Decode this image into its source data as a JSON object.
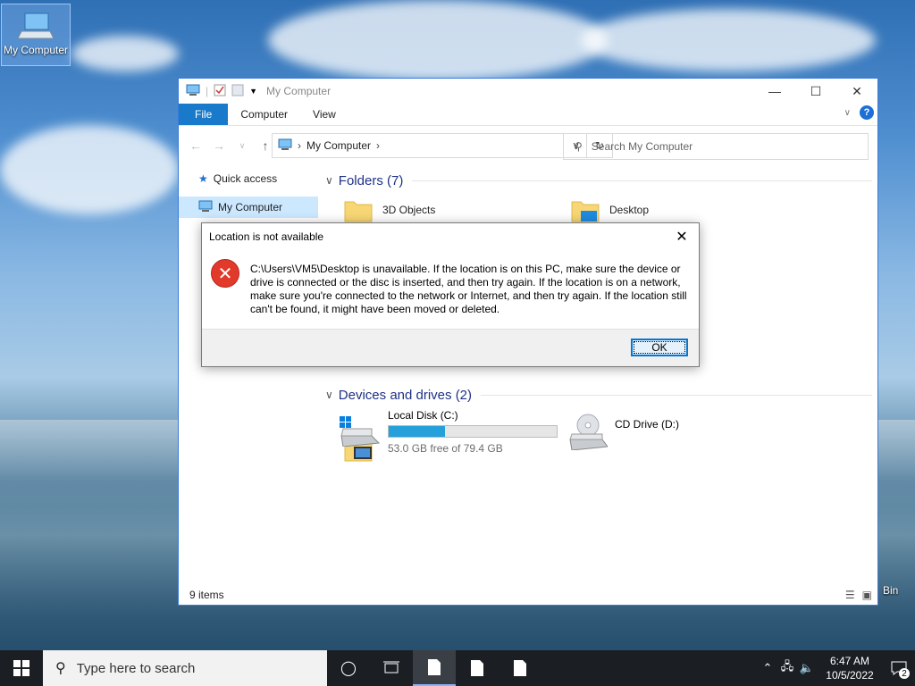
{
  "desktop": {
    "icons": [
      {
        "label": "My Computer"
      },
      {
        "label": "Bin"
      }
    ]
  },
  "explorer": {
    "title": "My Computer",
    "ribbon_tabs": [
      "File",
      "Computer",
      "View"
    ],
    "address": {
      "crumb": "My Computer"
    },
    "search": {
      "placeholder": "Search My Computer"
    },
    "nav": [
      {
        "label": "Quick access",
        "icon": "star-icon"
      },
      {
        "label": "My Computer",
        "icon": "computer-icon",
        "selected": true
      }
    ],
    "folders_header": "Folders (7)",
    "folders": [
      {
        "name": "3D Objects"
      },
      {
        "name": "Desktop"
      }
    ],
    "drives_header": "Devices and drives (2)",
    "drives": [
      {
        "name": "Local Disk (C:)",
        "free": "53.0 GB free of 79.4 GB",
        "used_fraction": 0.333
      },
      {
        "name": "CD Drive (D:)"
      }
    ],
    "status": "9 items"
  },
  "dialog": {
    "title": "Location is not available",
    "message": "C:\\Users\\VM5\\Desktop is unavailable. If the location is on this PC, make sure the device or drive is connected or the disc is inserted, and then try again. If the location is on a network, make sure you're connected to the network or Internet, and then try again. If the location still can't be found, it might have been moved or deleted.",
    "ok_label": "OK"
  },
  "taskbar": {
    "search_placeholder": "Type here to search",
    "time": "6:47 AM",
    "date": "10/5/2022",
    "notification_count": "2"
  },
  "colors": {
    "accent": "#1979ca",
    "error": "#e23a2a",
    "drive_fill": "#26a0da"
  }
}
